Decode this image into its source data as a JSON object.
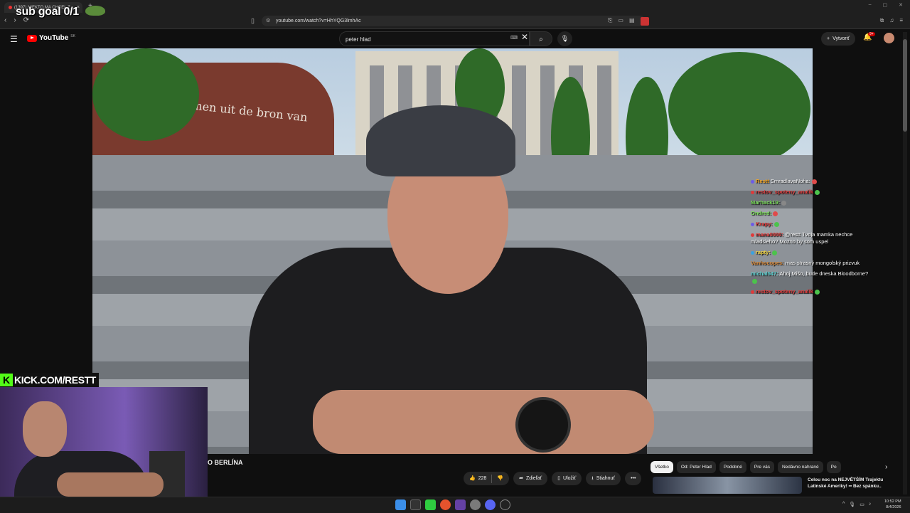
{
  "browser": {
    "tab_title": "(1397) NIEKTO MA CHCEL Z...",
    "tab_close": "×",
    "new_tab": "+",
    "window_controls": [
      "–",
      "▢",
      "✕"
    ],
    "nav": [
      "‹",
      "›",
      "⟳"
    ],
    "url": "youtube.com/watch?v=HhYQG3lmhAc"
  },
  "overlay": {
    "sub_goal": "sub goal 0/1",
    "kick_letter": "K",
    "kick_url": "KICK.COM/RESTT"
  },
  "youtube": {
    "logo_text": "YouTube",
    "region": "SK",
    "search_value": "peter hlad",
    "create_label": "Vytvoriť",
    "notif_count": "9+"
  },
  "video": {
    "sign_text": "komen uit de bron van"
  },
  "chat": [
    {
      "user": "Restt",
      "user_color": "#f5a623",
      "text": "SmradlavaNoha:",
      "badge": "#6c5ce7",
      "emote": "#e04a4a"
    },
    {
      "user": "restov_spoteny_analik",
      "user_color": "#e03a3a",
      "text": "",
      "badge": "#e03a3a",
      "emote": "#4cc34c"
    },
    {
      "user": "Marhack19:",
      "user_color": "#7bdc5a",
      "text": "",
      "badge": "",
      "emote": "#888888"
    },
    {
      "user": "Ondred:",
      "user_color": "#7bdc5a",
      "text": "",
      "badge": "",
      "emote": "#e04a4a"
    },
    {
      "user": "Krapy:",
      "user_color": "#e03a3a",
      "text": "",
      "badge": "#6c5ce7",
      "emote": "#4cc34c"
    },
    {
      "user": "mana0000:",
      "user_color": "#e03a3a",
      "text": "@restt Tvoja mamka nechce mladsieho? Mozno by som uspel",
      "badge": "#e03a3a",
      "emote": ""
    },
    {
      "user": "rapty:",
      "user_color": "#f5d742",
      "text": "",
      "badge": "#3aa3e0",
      "emote": "#4cc34c"
    },
    {
      "user": "Vanhocopes:",
      "user_color": "#d98a3a",
      "text": "mas strasný mongolský prizvuk",
      "badge": "",
      "emote": ""
    },
    {
      "user": "michal547:",
      "user_color": "#5ad1d1",
      "text": "Ahoj Mišo, bude dneska Bloodborne?",
      "badge": "",
      "emote": "#4cc34c"
    },
    {
      "user": "restov_spoteny_analik",
      "user_color": "#e03a3a",
      "text": "",
      "badge": "#e03a3a",
      "emote": "#4cc34c"
    }
  ],
  "watch": {
    "title": "O BERLÍNA",
    "like_count": "228",
    "share_label": "Zdieľať",
    "save_label": "Uložiť",
    "download_label": "Stiahnuť",
    "more_label": "•••"
  },
  "chips": [
    "Všetko",
    "Od: Peter Hlad",
    "Podobné",
    "Pre vás",
    "Nedávno nahrané",
    "Po"
  ],
  "recommendation": {
    "title": "Celou noc na NEJVĚTŠÍM Trajektu Latinské Ameriky! ▪▪ Bez spánku.."
  },
  "taskbar": {
    "time": "10:52 PM",
    "date": "8/4/2026"
  },
  "colors": {
    "youtube_red": "#ff0000",
    "kick_green": "#53fc18"
  }
}
